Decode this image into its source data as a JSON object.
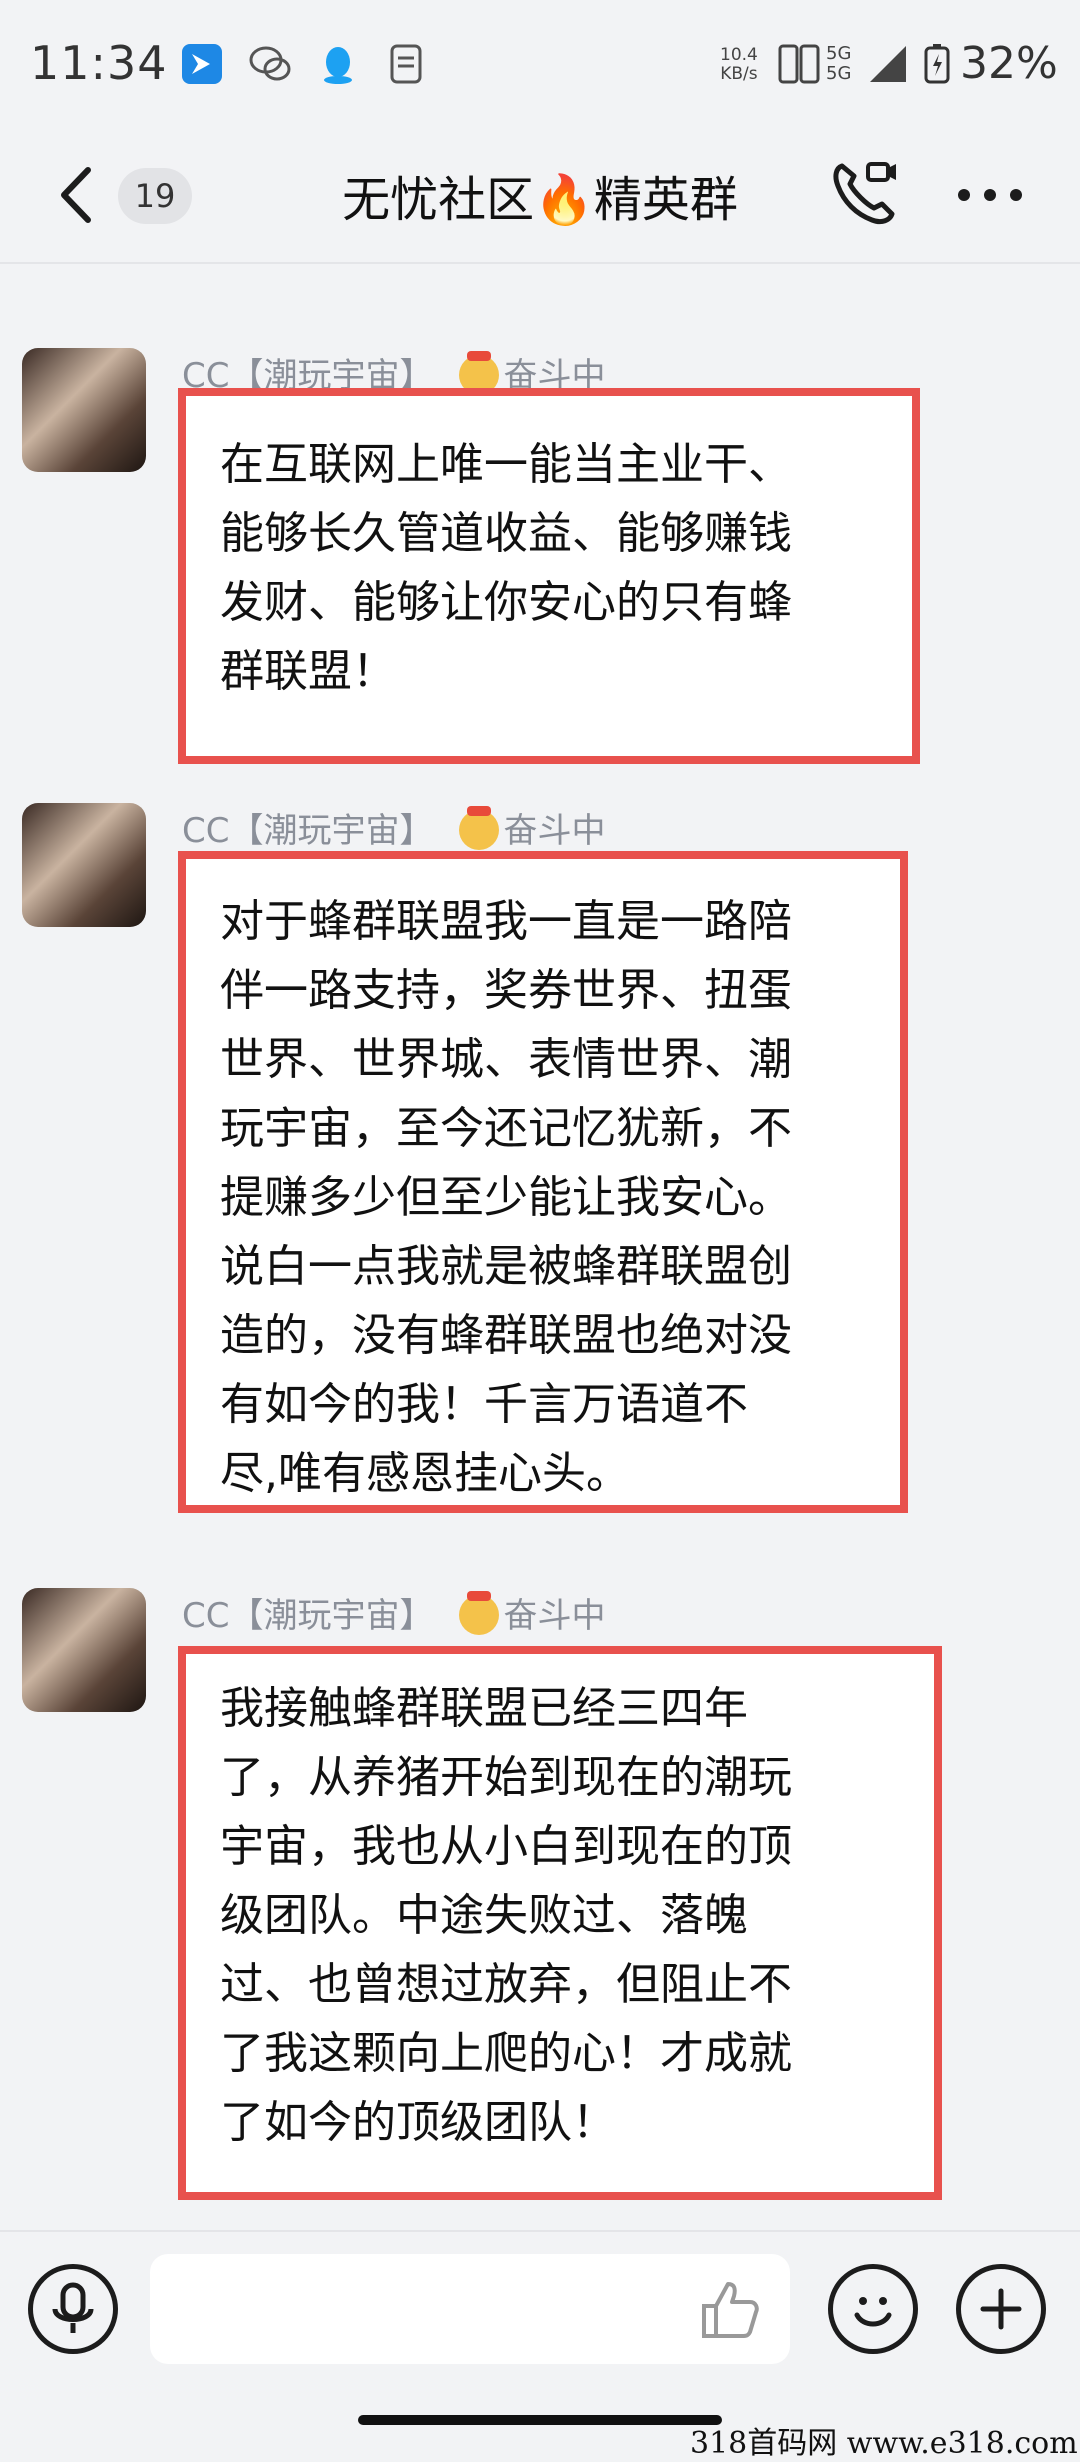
{
  "status_bar": {
    "time": "11:34",
    "net_speed_value": "10.4",
    "net_speed_unit": "KB/s",
    "signal_top": "5G",
    "signal_bottom": "5G",
    "battery": "32%",
    "icons": [
      "feishu-icon",
      "wechat-icon",
      "qq-icon",
      "notes-icon",
      "hd-icon",
      "signal-icon",
      "battery-icon"
    ]
  },
  "header": {
    "unread_count": "19",
    "title": "无忧社区🔥精英群"
  },
  "messages": [
    {
      "sender": "CC【潮玩宇宙】",
      "status": "奋斗中",
      "lines": [
        "在互联网上唯一能当主业干、",
        "能够长久管道收益、能够赚钱",
        "发财、能够让你安心的只有蜂",
        "群联盟！"
      ]
    },
    {
      "sender": "CC【潮玩宇宙】",
      "status": "奋斗中",
      "lines": [
        "对于蜂群联盟我一直是一路陪",
        "伴一路支持，奖券世界、扭蛋",
        "世界、世界城、表情世界、潮",
        "玩宇宙，至今还记忆犹新，不",
        "提赚多少但至少能让我安心。",
        "说白一点我就是被蜂群联盟创",
        "造的，没有蜂群联盟也绝对没",
        "有如今的我！千言万语道不",
        "尽,唯有感恩挂心头。"
      ]
    },
    {
      "sender": "CC【潮玩宇宙】",
      "status": "奋斗中",
      "lines": [
        "我接触蜂群联盟已经三四年",
        "了，从养猪开始到现在的潮玩",
        "宇宙，我也从小白到现在的顶",
        "级团队。中途失败过、落魄",
        "过、也曾想过放弃，但阻止不",
        "了我这颗向上爬的心！才成就",
        "了如今的顶级团队！"
      ]
    }
  ],
  "input": {
    "placeholder": ""
  },
  "watermark": "318首码网  www.e318.com",
  "colors": {
    "highlight_border": "#e8514d",
    "background": "#f2f3f5",
    "sender_text": "#8a8f99"
  }
}
